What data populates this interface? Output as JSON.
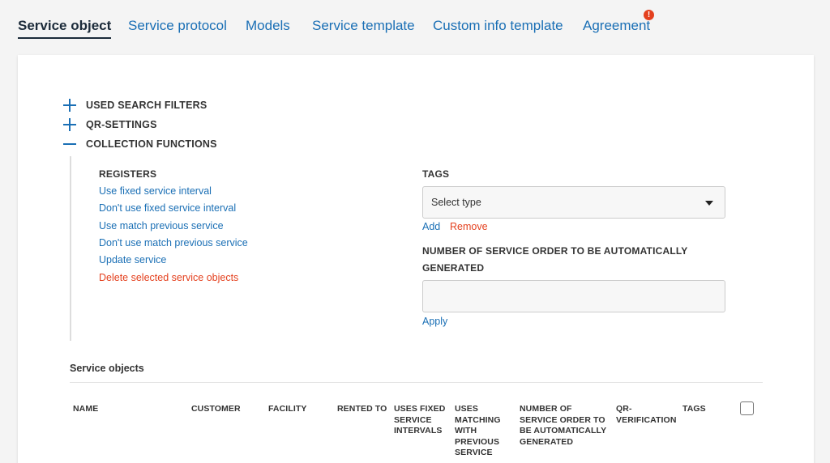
{
  "tabs": [
    {
      "label": "Service object",
      "active": true
    },
    {
      "label": "Service protocol"
    },
    {
      "label": "Models"
    },
    {
      "label": "Service template"
    },
    {
      "label": "Custom info template"
    },
    {
      "label": "Agreement",
      "badge": "!"
    }
  ],
  "sections": {
    "used_search_filters": "USED SEARCH FILTERS",
    "qr_settings": "QR-SETTINGS",
    "collection_functions": "COLLECTION FUNCTIONS"
  },
  "registers": {
    "title": "REGISTERS",
    "links": [
      "Use fixed service interval",
      "Don't use fixed service interval",
      "Use match previous service",
      "Don't use match previous service",
      "Update service",
      "Delete selected service objects"
    ]
  },
  "tags": {
    "title": "TAGS",
    "select_placeholder": "Select type",
    "add_label": "Add",
    "remove_label": "Remove"
  },
  "auto_generate": {
    "title_line1": "NUMBER OF SERVICE ORDER TO BE AUTOMATICALLY",
    "title_line2": "GENERATED",
    "value": "",
    "apply_label": "Apply"
  },
  "service_objects": {
    "title": "Service objects",
    "columns": [
      "NAME",
      "CUSTOMER",
      "FACILITY",
      "RENTED TO",
      "USES FIXED SERVICE INTERVALS",
      "USES MATCHING WITH PREVIOUS SERVICE",
      "NUMBER OF SERVICE ORDER TO BE AUTOMATICALLY GENERATED",
      "QR-VERIFICATION",
      "TAGS"
    ]
  },
  "colors": {
    "link": "#1a6fb5",
    "danger": "#e4401e",
    "active_tab": "#1c2b3a",
    "badge": "#e4401e"
  }
}
